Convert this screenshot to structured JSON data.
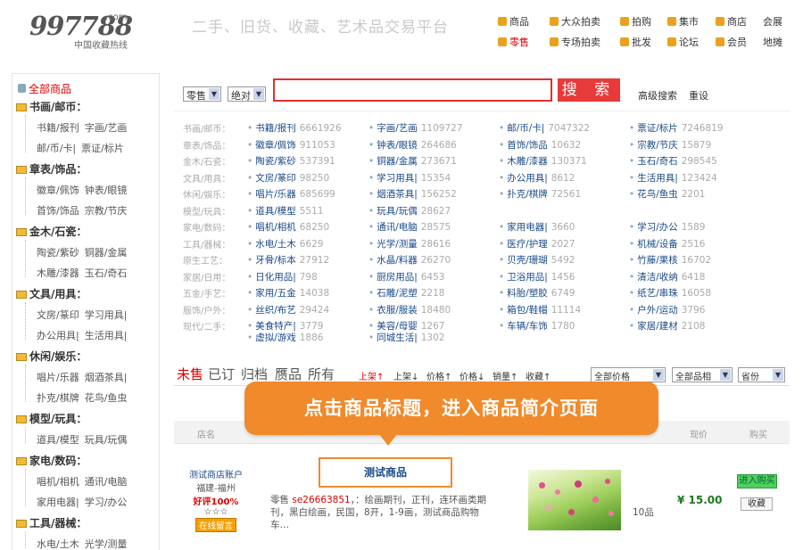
{
  "logo": {
    "number": "997788",
    "dotcom": ".com",
    "name": "中国收藏热线"
  },
  "slogan": "二手、旧货、收藏、艺术品交易平台",
  "topnav": {
    "row1": [
      "商品",
      "大众拍卖",
      "拍购",
      "集市",
      "商店",
      "会展"
    ],
    "row2": [
      "零售",
      "专场拍卖",
      "批发",
      "论坛",
      "会员",
      "地摊"
    ]
  },
  "sidebar": {
    "all": "全部商品",
    "groups": [
      {
        "title": "书画/邮币：",
        "rows": [
          [
            "书籍/报刊",
            "字画/艺画"
          ],
          [
            "邮/币/卡|",
            "票证/标片"
          ]
        ]
      },
      {
        "title": "章表/饰品：",
        "rows": [
          [
            "徽章/佩饰",
            "钟表/眼镜"
          ],
          [
            "首饰/饰品",
            "宗教/节庆"
          ]
        ]
      },
      {
        "title": "金木/石瓷：",
        "rows": [
          [
            "陶瓷/紫砂",
            "铜器/金属"
          ],
          [
            "木雕/漆器",
            "玉石/奇石"
          ]
        ]
      },
      {
        "title": "文具/用具：",
        "rows": [
          [
            "文房/篆印",
            "学习用具|"
          ],
          [
            "办公用具|",
            "生活用具|"
          ]
        ]
      },
      {
        "title": "休闲/娱乐：",
        "rows": [
          [
            "唱片/乐器",
            "烟酒茶具|"
          ],
          [
            "扑克/棋牌",
            "花鸟/鱼虫"
          ]
        ]
      },
      {
        "title": "模型/玩具：",
        "rows": [
          [
            "道具/模型",
            "玩具/玩偶"
          ]
        ]
      },
      {
        "title": "家电/数码：",
        "rows": [
          [
            "唱机/相机",
            "通讯/电脑"
          ],
          [
            "家用电器|",
            "学习/办公"
          ]
        ]
      },
      {
        "title": "工具/器械：",
        "rows": [
          [
            "水电/土木",
            "光学/测量"
          ]
        ]
      }
    ]
  },
  "search": {
    "sel1": "零售",
    "sel2": "绝对",
    "button": "搜 索",
    "advanced": "高级搜索",
    "reset": "重设"
  },
  "cats": [
    {
      "big": "书画/邮币：",
      "items": [
        [
          "书籍/报刊",
          "6661926"
        ],
        [
          "字画/艺画",
          "1109727"
        ],
        [
          "邮/币/卡|",
          "7047322"
        ],
        [
          "票证/标片",
          "7246819"
        ]
      ]
    },
    {
      "big": "章表/饰品：",
      "items": [
        [
          "徽章/佩饰",
          "911053"
        ],
        [
          "钟表/眼镜",
          "264686"
        ],
        [
          "首饰/饰品",
          "10632"
        ],
        [
          "宗教/节庆",
          "15879"
        ]
      ]
    },
    {
      "big": "金木/石瓷：",
      "items": [
        [
          "陶瓷/紫砂",
          "537391"
        ],
        [
          "铜器/金属",
          "273671"
        ],
        [
          "木雕/漆器",
          "130371"
        ],
        [
          "玉石/奇石",
          "298545"
        ]
      ]
    },
    {
      "big": "文具/用具：",
      "items": [
        [
          "文房/篆印",
          "98250"
        ],
        [
          "学习用具|",
          "15354"
        ],
        [
          "办公用具|",
          "8612"
        ],
        [
          "生活用具|",
          "123424"
        ]
      ]
    },
    {
      "big": "休闲/娱乐：",
      "items": [
        [
          "唱片/乐器",
          "685699"
        ],
        [
          "烟酒茶具|",
          "156252"
        ],
        [
          "扑克/棋牌",
          "72561"
        ],
        [
          "花鸟/鱼虫",
          "2201"
        ]
      ]
    },
    {
      "big": "模型/玩具：",
      "items": [
        [
          "道具/模型",
          "5511"
        ],
        [
          "玩具/玩偶",
          "28627"
        ]
      ]
    },
    {
      "big": "家电/数码：",
      "items": [
        [
          "唱机/相机",
          "68250"
        ],
        [
          "通讯/电脑",
          "28575"
        ],
        [
          "家用电器|",
          "3660"
        ],
        [
          "学习/办公",
          "1589"
        ]
      ]
    },
    {
      "big": "工具/器械：",
      "items": [
        [
          "水电/土木",
          "6629"
        ],
        [
          "光学/测量",
          "28616"
        ],
        [
          "医疗/护理",
          "2027"
        ],
        [
          "机械/设备",
          "2516"
        ]
      ]
    },
    {
      "big": "原生工艺：",
      "items": [
        [
          "牙骨/标本",
          "27912"
        ],
        [
          "水晶/料器",
          "26270"
        ],
        [
          "贝壳/珊瑚",
          "5492"
        ],
        [
          "竹藤/果核",
          "16702"
        ]
      ]
    },
    {
      "big": "家居/日用：",
      "items": [
        [
          "日化用品|",
          "798"
        ],
        [
          "厨房用品|",
          "6453"
        ],
        [
          "卫浴用品|",
          "1456"
        ],
        [
          "清洁/收纳",
          "6418"
        ]
      ]
    },
    {
      "big": "五金/手艺：",
      "items": [
        [
          "家用/五金",
          "14038"
        ],
        [
          "石雕/泥塑",
          "2218"
        ],
        [
          "料胎/塑胶",
          "6749"
        ],
        [
          "纸艺/串珠",
          "16058"
        ]
      ]
    },
    {
      "big": "服饰/户外：",
      "items": [
        [
          "丝织/布艺",
          "29424"
        ],
        [
          "衣服/服装",
          "18480"
        ],
        [
          "箱包/鞋帽",
          "11114"
        ],
        [
          "户外/运动",
          "3796"
        ]
      ]
    },
    {
      "big": "现代/二手：",
      "items": [
        [
          "美食特产|",
          "3779"
        ],
        [
          "美容/母婴",
          "1267"
        ],
        [
          "车辆/车饰",
          "1780"
        ],
        [
          "家居/建材",
          "2108"
        ]
      ]
    },
    {
      "big": "",
      "items": [
        [
          "虚拟/游戏",
          "1886"
        ],
        [
          "同城生活|",
          "1302"
        ]
      ]
    }
  ],
  "tabs": [
    "未售",
    "已订",
    "归档",
    "赝品",
    "所有"
  ],
  "sorts": [
    "上架↑",
    "上架↓",
    "价格↑",
    "价格↓",
    "销量↑",
    "收藏↑"
  ],
  "filters": {
    "price": "全部价格",
    "type": "全部品相",
    "province": "省份"
  },
  "columns": {
    "shop": "店名",
    "price": "现价",
    "buy": "购买"
  },
  "callout": "点击商品标题，进入商品简介页面",
  "product": {
    "shop": "测试商店账户",
    "location": "福建-福州",
    "rating": "好评100%",
    "stars": "☆☆☆",
    "message": "在线留言",
    "title": "测试商品",
    "desc_prefix": "零售",
    "desc_id": "se26663851",
    "desc_rest": "，：绘画期刊，正刊，连环画类期刊，黑白绘画，民国，8开，1-9画，测试商品购物车…",
    "qty": "10品",
    "price": "¥ 15.00",
    "buy": "进入购买",
    "fav": "收藏"
  }
}
